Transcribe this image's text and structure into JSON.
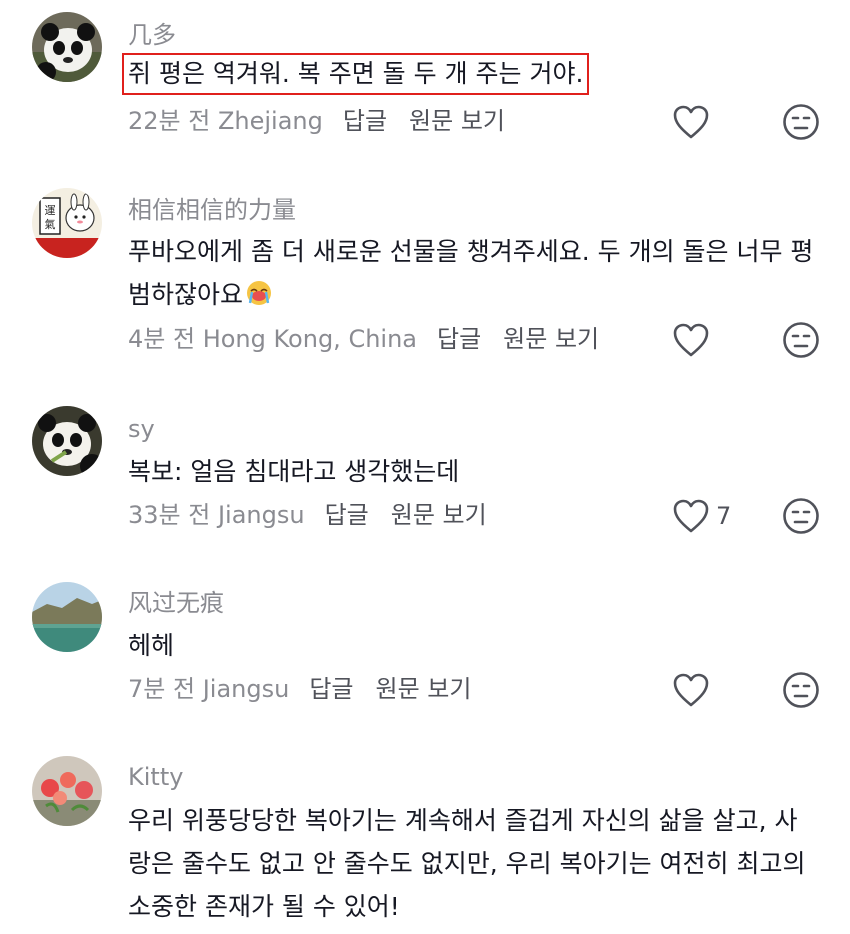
{
  "comments": [
    {
      "username": "几多",
      "text": "쥐 평은 역겨워. 복 주면 돌 두 개 주는 거야.",
      "time": "22분 전",
      "location": "Zhejiang",
      "reply_label": "답글",
      "original_label": "원문 보기",
      "likes": "",
      "highlighted": true,
      "avatar": "panda-avatar"
    },
    {
      "username": "相信相信的力量",
      "text": "푸바오에게 좀 더 새로운 선물을 챙겨주세요. 두 개의 돌은 너무 평범하잖아요",
      "time": "4분 전",
      "location": "Hong Kong, China",
      "reply_label": "답글",
      "original_label": "원문 보기",
      "likes": "",
      "avatar": "lucky-rabbit-avatar",
      "emoji": "crying-emoji"
    },
    {
      "username": "sy",
      "text": "복보: 얼음 침대라고 생각했는데",
      "time": "33분 전",
      "location": "Jiangsu",
      "reply_label": "답글",
      "original_label": "원문 보기",
      "likes": "7",
      "avatar": "panda-avatar"
    },
    {
      "username": "风过无痕",
      "text": "헤헤",
      "time": "7분 전",
      "location": "Jiangsu",
      "reply_label": "답글",
      "original_label": "원문 보기",
      "likes": "",
      "avatar": "landscape-avatar"
    },
    {
      "username": "Kitty",
      "text": "우리 위풍당당한 복아기는 계속해서 즐겁게 자신의 삶을 살고, 사랑은 줄수도 없고 안 줄수도 없지만, 우리 복아기는 여전히 최고의 소중한 존재가 될 수 있어!",
      "time": "",
      "location": "",
      "likes": "",
      "avatar": "flowers-avatar"
    }
  ],
  "colors": {
    "text": "#161823",
    "secondary": "#8a8b91",
    "action": "#50525a",
    "highlight_border": "#e0201c"
  },
  "icons": {
    "like": "heart-outline-icon",
    "dislike": "neutral-face-icon"
  }
}
